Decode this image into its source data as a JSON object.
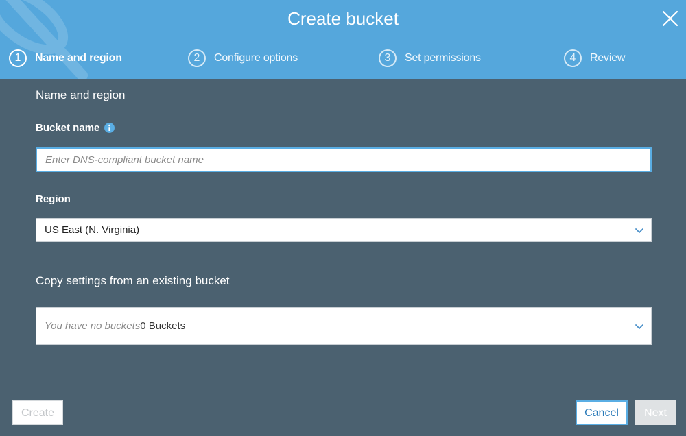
{
  "dialog": {
    "title": "Create bucket"
  },
  "steps": [
    {
      "number": "1",
      "label": "Name and region",
      "active": true
    },
    {
      "number": "2",
      "label": "Configure options",
      "active": false
    },
    {
      "number": "3",
      "label": "Set permissions",
      "active": false
    },
    {
      "number": "4",
      "label": "Review",
      "active": false
    }
  ],
  "section": {
    "title": "Name and region"
  },
  "bucket_name": {
    "label": "Bucket name",
    "value": "",
    "placeholder": "Enter DNS-compliant bucket name"
  },
  "region": {
    "label": "Region",
    "selected": "US East (N. Virginia)"
  },
  "copy_settings": {
    "title": "Copy settings from an existing bucket",
    "placeholder": "You have no buckets",
    "count": "0 Buckets"
  },
  "buttons": {
    "create": "Create",
    "cancel": "Cancel",
    "next": "Next"
  },
  "icons": {
    "close": "close-icon",
    "info": "info-icon",
    "chevron": "chevron-down-icon"
  },
  "colors": {
    "header": "#55a7dc",
    "body": "#4b6170",
    "accent": "#5aaee4",
    "link": "#2b7bb9"
  }
}
